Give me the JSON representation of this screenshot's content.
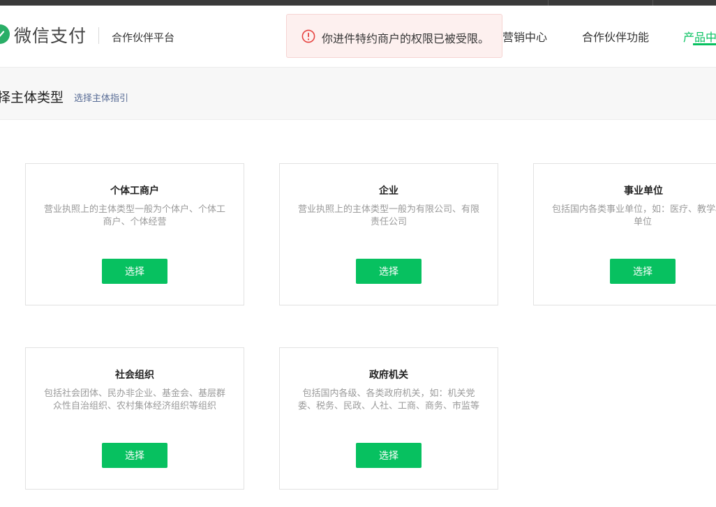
{
  "header": {
    "logo_text": "微信支付",
    "platform_name": "合作伙伴平台",
    "nav": [
      {
        "label": "营销中心"
      },
      {
        "label": "合作伙伴功能"
      },
      {
        "label": "产品中"
      }
    ]
  },
  "toast": {
    "message": "你进件特约商户的权限已被受限。"
  },
  "subheader": {
    "title": "择主体类型",
    "guide_link": "选择主体指引"
  },
  "cards": [
    {
      "title": "个体工商户",
      "desc": "营业执照上的主体类型一般为个体户、个体工商户、个体经营",
      "button": "选择"
    },
    {
      "title": "企业",
      "desc": "营业执照上的主体类型一般为有限公司、有限责任公司",
      "button": "选择"
    },
    {
      "title": "事业单位",
      "desc": "包括国内各类事业单位，如：医疗、教学校等单位",
      "button": "选择"
    },
    {
      "title": "社会组织",
      "desc": "包括社会团体、民办非企业、基金会、基层群众性自治组织、农村集体经济组织等组织",
      "button": "选择"
    },
    {
      "title": "政府机关",
      "desc": "包括国内各级、各类政府机关，如：机关党委、税务、民政、人社、工商、商务、市监等",
      "button": "选择"
    }
  ],
  "colors": {
    "brand_green": "#07c160",
    "link_blue": "#576b95",
    "error_red": "#e64340"
  }
}
